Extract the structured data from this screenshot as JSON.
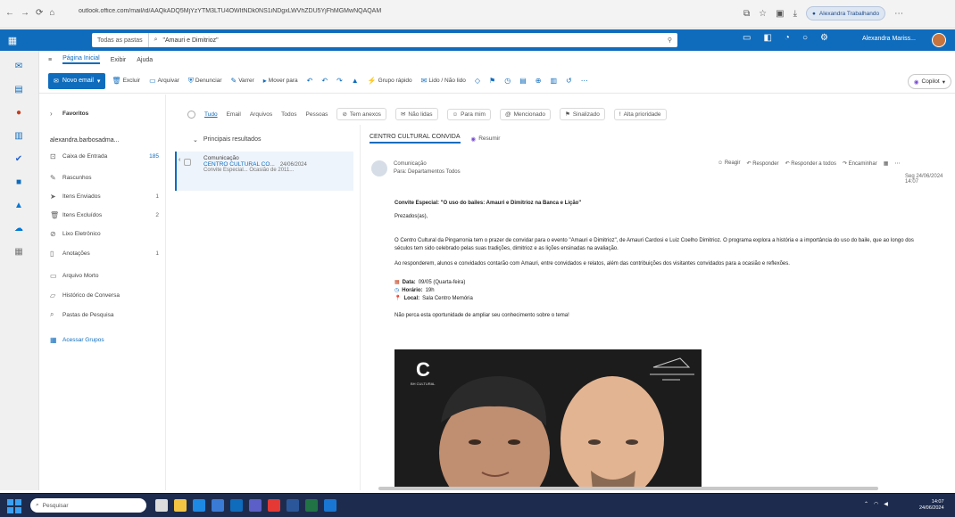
{
  "browser": {
    "url": "outlook.office.com/mail/id/AAQkADQ5MjYzYTM3LTU4OWItNDk0NS1iNDgxLWVhZDU5YjFhMGMwNQAQAM",
    "profile": "Alexandra Trabalhando"
  },
  "header": {
    "search_scope": "Todas as pastas",
    "search_query": "\"Amauri e Dimitrioz\"",
    "user_name": "Alexandra Mariss..."
  },
  "tabs": [
    "Página Inicial",
    "Exibir",
    "Ajuda"
  ],
  "ribbon": {
    "new_mail": "Novo email",
    "buttons": [
      "Excluir",
      "Arquivar",
      "Denunciar",
      "Varrer",
      "Mover para",
      "Grupo rápido",
      "Lido / Não lido",
      "Copilot"
    ]
  },
  "folders": {
    "favorites_label": "Favoritos",
    "account": "alexandra.barbosadma...",
    "items": [
      {
        "label": "Caixa de Entrada",
        "count": "185"
      },
      {
        "label": "Rascunhos",
        "count": ""
      },
      {
        "label": "Itens Enviados",
        "count": "1"
      },
      {
        "label": "Itens Excluídos",
        "count": "2"
      },
      {
        "label": "Lixo Eletrônico",
        "count": ""
      },
      {
        "label": "Anotações",
        "count": "1"
      },
      {
        "label": "Arquivo Morto",
        "count": ""
      },
      {
        "label": "Histórico de Conversa",
        "count": ""
      },
      {
        "label": "Pastas de Pesquisa",
        "count": ""
      },
      {
        "label": "Acessar Grupos",
        "count": ""
      }
    ]
  },
  "filters": {
    "items": [
      "Tudo",
      "Email",
      "Arquivos",
      "Todos",
      "Pessoas"
    ],
    "pills": [
      "Tem anexos",
      "Não lidas",
      "Para mim",
      "Mencionado",
      "Sinalizado",
      "Alta prioridade"
    ]
  },
  "message_list": {
    "group": "Principais resultados",
    "item": {
      "sender": "Comunicação",
      "subject": "CENTRO CULTURAL CO...",
      "date": "24/06/2024",
      "preview": "Convite Especial...   Ocasião de 2011..."
    }
  },
  "reading": {
    "subject": "CENTRO CULTURAL CONVIDA",
    "summary_label": "Resumir",
    "sender": "Comunicação",
    "to": "Para: Departamentos Todos",
    "actions": [
      "Reagir",
      "Responder",
      "Responder a todos",
      "Encaminhar"
    ],
    "date": "Seg 24/06/2024 14:07",
    "headline": "Convite Especial: \"O uso do bailes: Amauri e Dimitrioz na Banca e Lição\"",
    "greeting": "Prezados(as),",
    "p1": "O Centro Cultural da Pingarronia tem o prazer de convidar para o evento \"Amauri e Dimitrioz\", de Amauri Cardosi e Luiz Coelho Dimitrioz. O programa explora a história e a importância do uso do baile, que ao longo dos séculos tem sido celebrado pelas suas tradições, dimitrioz e as lições ensinadas na avaliação.",
    "p2": "Ao responderem, alunos e convidados contarão com Amauri, entre convidados e relatos, além das contribuições dos visitantes convidados para a ocasião e reflexões.",
    "data_label": "Data:",
    "data_value": "09/05 (Quarta-feira)",
    "horario_label": "Horário:",
    "horario_value": "19h",
    "local_label": "Local:",
    "local_value": "Sala Centro Memória",
    "closing": "Não perca esta oportunidade de ampliar seu conhecimento sobre o tema!",
    "banner_text": "BH CULTURAL"
  },
  "taskbar": {
    "search_placeholder": "Pesquisar",
    "time": "14:07",
    "date": "24/06/2024"
  }
}
